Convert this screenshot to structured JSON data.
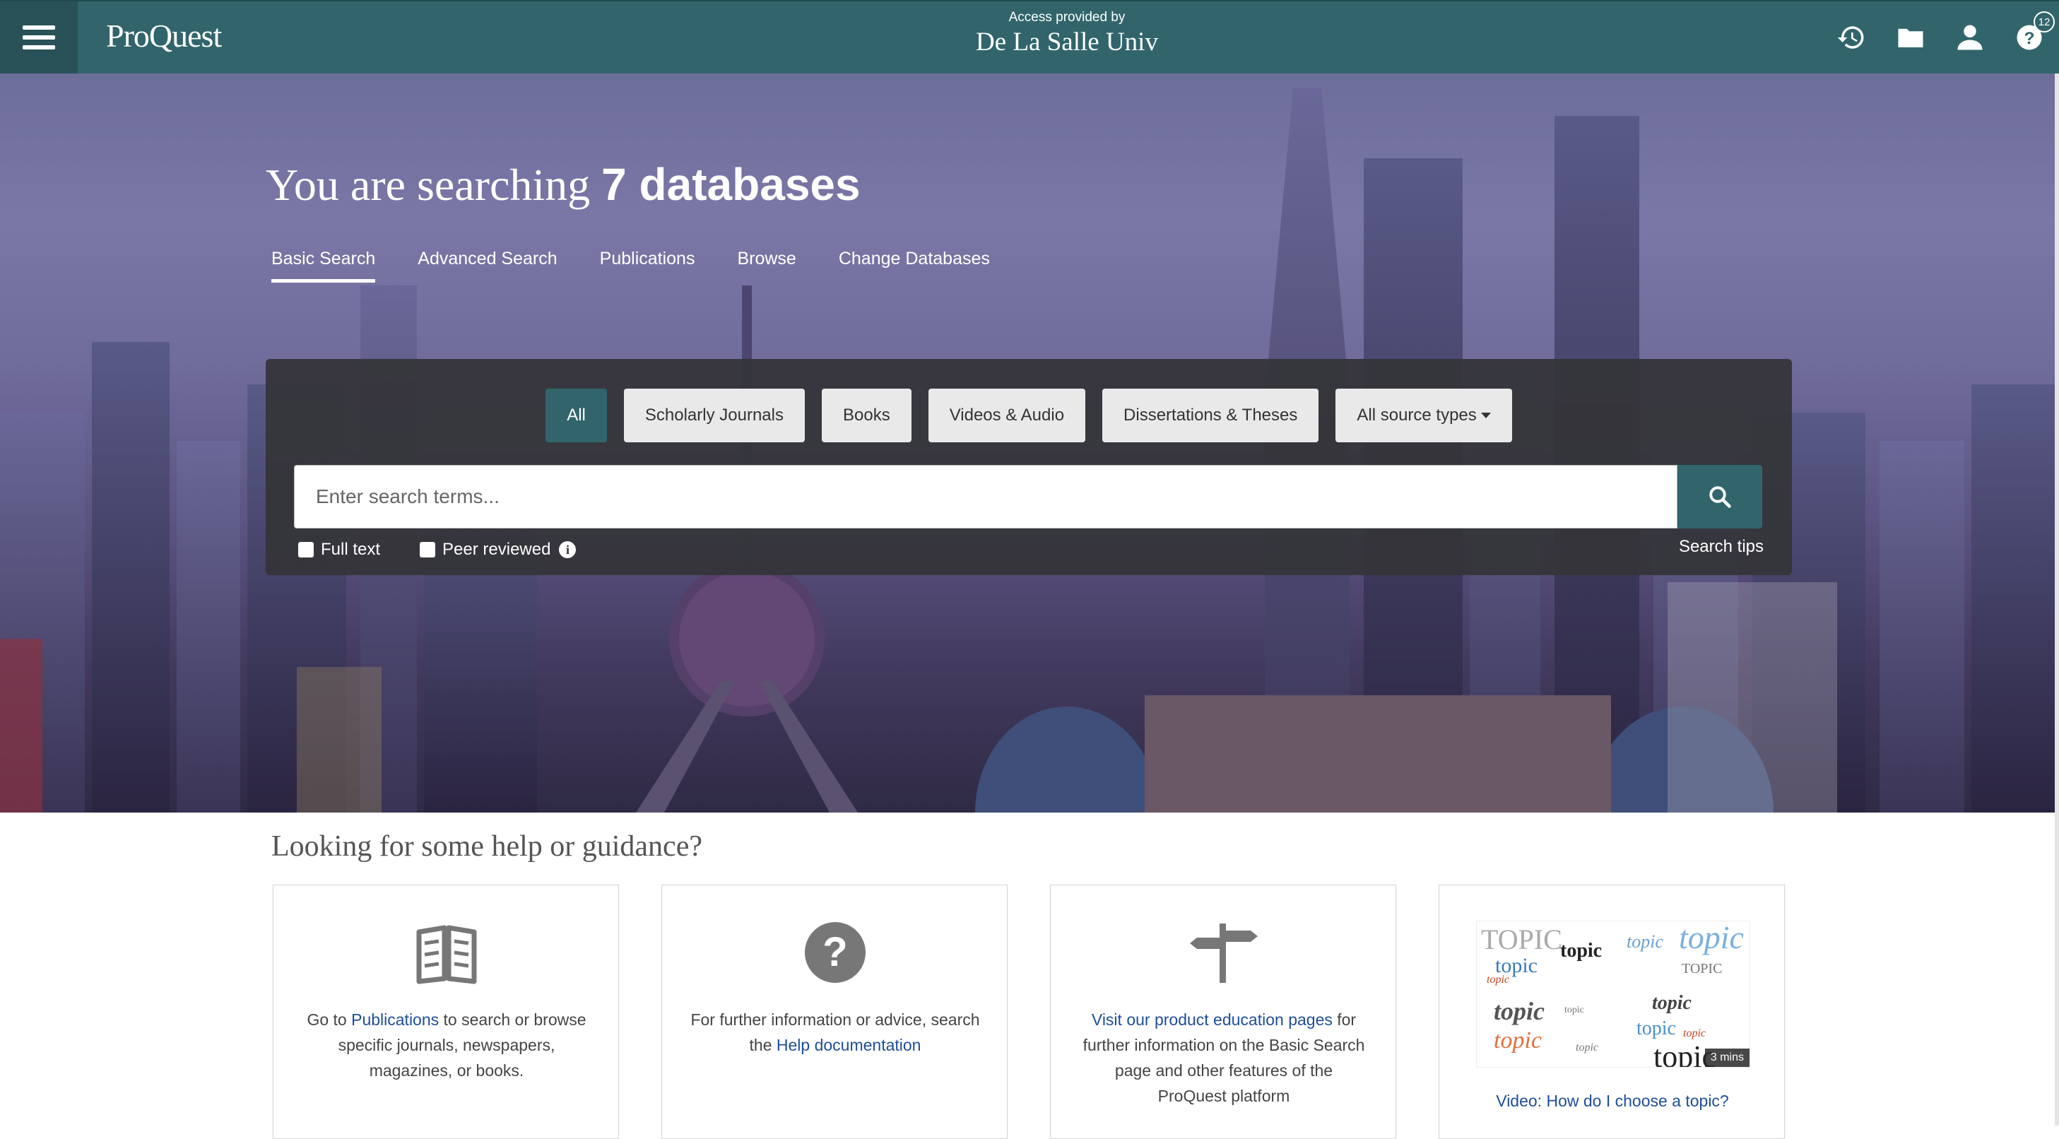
{
  "header": {
    "logo": "ProQuest",
    "access_label": "Access provided by",
    "institution": "De La Salle Univ",
    "icons": [
      "history-icon",
      "folder-icon",
      "user-icon",
      "help-icon"
    ],
    "help_badge": "12"
  },
  "hero": {
    "title_prefix": "You are searching",
    "title_count": "7 databases",
    "tabs": [
      "Basic Search",
      "Advanced Search",
      "Publications",
      "Browse",
      "Change Databases"
    ],
    "active_tab": "Basic Search"
  },
  "search": {
    "source_types": [
      "All",
      "Scholarly Journals",
      "Books",
      "Videos & Audio",
      "Dissertations & Theses",
      "All source types"
    ],
    "active_source": "All",
    "placeholder": "Enter search terms...",
    "value": "",
    "full_text_label": "Full text",
    "full_text_checked": false,
    "peer_reviewed_label": "Peer reviewed",
    "peer_reviewed_checked": false,
    "tips_label": "Search tips"
  },
  "help": {
    "heading": "Looking for some help or guidance?",
    "cards": [
      {
        "icon": "book-icon",
        "pre": "Go to ",
        "link": "Publications",
        "post": " to search or browse specific journals, newspapers, magazines, or books."
      },
      {
        "icon": "question-circle-icon",
        "pre": "For further information or advice, search the ",
        "link": "Help documentation",
        "post": ""
      },
      {
        "icon": "signpost-icon",
        "pre": "",
        "link": "Visit our product education pages",
        "post": " for further information on the Basic Search page and other features of the ProQuest platform"
      },
      {
        "icon": "video-thumbnail",
        "thumb_word": "topic",
        "thumb_word_caps": "TOPIC",
        "duration": "3 mins",
        "link": "Video: How do I choose a topic?"
      }
    ]
  },
  "colors": {
    "brand_teal": "#31656b",
    "link_blue": "#1e4e9c"
  }
}
